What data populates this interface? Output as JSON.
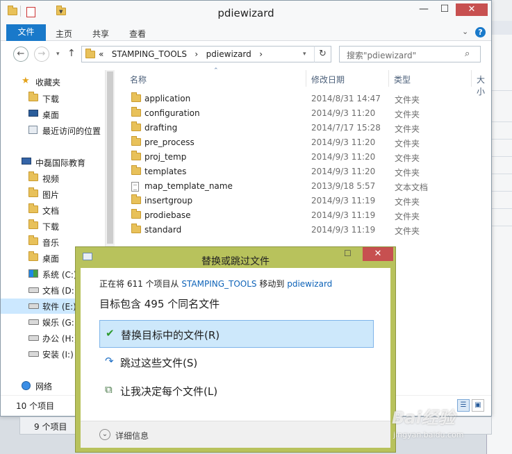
{
  "window": {
    "title": "pdiewizard",
    "minimize": "—",
    "maximize": "☐",
    "close": "✕"
  },
  "ribbon": {
    "tabs": [
      "文件",
      "主页",
      "共享",
      "查看"
    ],
    "help": "?"
  },
  "nav": {
    "back": "←",
    "forward": "→",
    "up": "↑",
    "breadcrumb_prefix": "«",
    "breadcrumb": [
      "STAMPING_TOOLS",
      "pdiewizard"
    ],
    "breadcrumb_sep": "›",
    "refresh": "↻"
  },
  "search": {
    "placeholder": "搜索\"pdiewizard\"",
    "icon": "search-icon"
  },
  "sidebar": {
    "favorites_label": "收藏夹",
    "favorites": [
      "下载",
      "桌面",
      "最近访问的位置"
    ],
    "computer_label": "中磊国际教育",
    "computer_items": [
      "视频",
      "图片",
      "文档",
      "下载",
      "音乐",
      "桌面",
      "系统 (C:)",
      "文档 (D:)",
      "软件 (E:)",
      "娱乐 (G:)",
      "办公 (H:)",
      "安装 (I:)"
    ],
    "network_label": "网络"
  },
  "columns": {
    "name": "名称",
    "date": "修改日期",
    "type": "类型",
    "size": "大小"
  },
  "files": [
    {
      "name": "application",
      "date": "2014/8/31 14:47",
      "type": "文件夹",
      "icon": "folder"
    },
    {
      "name": "configuration",
      "date": "2014/9/3 11:20",
      "type": "文件夹",
      "icon": "folder"
    },
    {
      "name": "drafting",
      "date": "2014/7/17 15:28",
      "type": "文件夹",
      "icon": "folder"
    },
    {
      "name": "pre_process",
      "date": "2014/9/3 11:20",
      "type": "文件夹",
      "icon": "folder"
    },
    {
      "name": "proj_temp",
      "date": "2014/9/3 11:20",
      "type": "文件夹",
      "icon": "folder"
    },
    {
      "name": "templates",
      "date": "2014/9/3 11:20",
      "type": "文件夹",
      "icon": "folder"
    },
    {
      "name": "map_template_name",
      "date": "2013/9/18 5:57",
      "type": "文本文档",
      "icon": "document"
    },
    {
      "name": "insertgroup",
      "date": "2014/9/3 11:19",
      "type": "文件夹",
      "icon": "folder"
    },
    {
      "name": "prodiebase",
      "date": "2014/9/3 11:19",
      "type": "文件夹",
      "icon": "folder"
    },
    {
      "name": "standard",
      "date": "2014/9/3 11:19",
      "type": "文件夹",
      "icon": "folder"
    }
  ],
  "status": {
    "count": "10 个项目",
    "bg_count": "9 个项目"
  },
  "dialog": {
    "title": "替换或跳过文件",
    "line1_a": "正在将 611 个项目从",
    "line1_src": "STAMPING_TOOLS",
    "line1_b": "移动到",
    "line1_dst": "pdiewizard",
    "heading": "目标包含 495 个同名文件",
    "options": [
      {
        "label": "替换目标中的文件(R)",
        "icon": "✔"
      },
      {
        "label": "跳过这些文件(S)",
        "icon": "↷"
      },
      {
        "label": "让我决定每个文件(L)",
        "icon": "⧉"
      }
    ],
    "details": "详细信息",
    "close": "✕",
    "maximize": "☐"
  },
  "watermark": {
    "brand": "Bai经验",
    "url": "jingyan.baidu.com"
  }
}
